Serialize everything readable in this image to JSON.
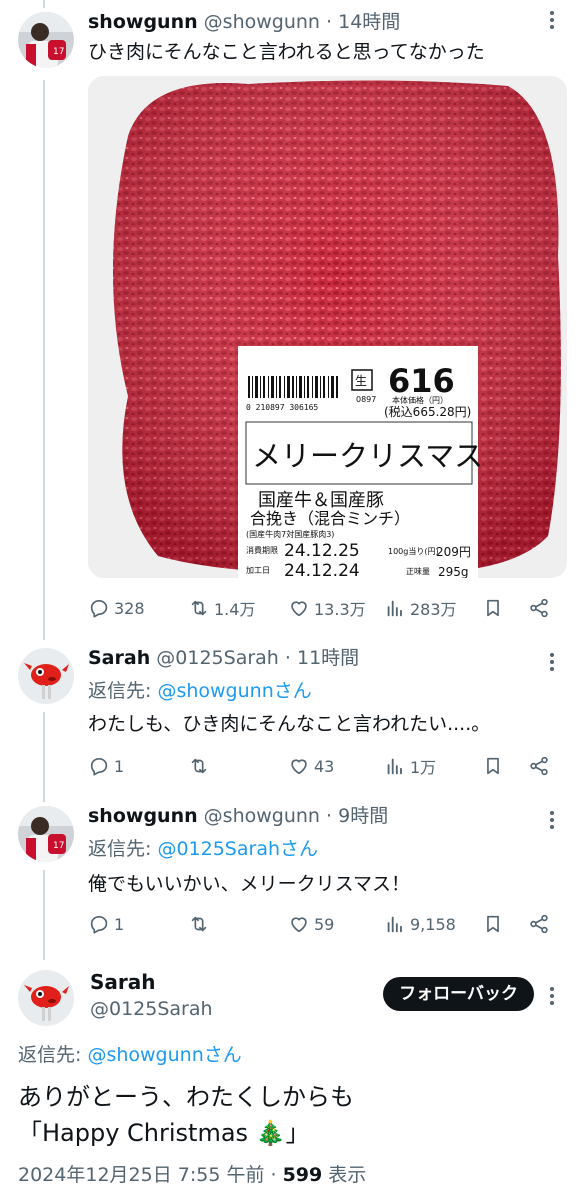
{
  "tweet1": {
    "name": "showgunn",
    "handle": "@showgunn",
    "sep": "·",
    "time": "14時間",
    "text": "ひき肉にそんなこと言われると思ってなかった",
    "image": {
      "label_price": "616",
      "label_price_note": "本体価格（円）",
      "label_tax_price": "(税込665.28円)",
      "label_message": "メリークリスマス",
      "label_product_line1": "国産牛＆国産豚",
      "label_product_line2": "合挽き（混合ミンチ）",
      "label_ratio": "(国産牛肉7対国産豚肉3)",
      "label_expiry_label": "消費期限",
      "label_expiry": "24.12.25",
      "label_unit_label": "100g当り(円)",
      "label_unit_price": "209円",
      "label_processed_label": "加工日",
      "label_processed": "24.12.24",
      "label_weight_label": "正味量",
      "label_weight": "295g",
      "label_barcode_num": "0 210897 306165",
      "label_code": "0897"
    },
    "stats": {
      "replies": "328",
      "retweets": "1.4万",
      "likes": "13.3万",
      "views": "283万"
    }
  },
  "tweet2": {
    "name": "Sarah",
    "handle": "@0125Sarah",
    "sep": "·",
    "time": "11時間",
    "reply_prefix": "返信先: ",
    "reply_mention": "@showgunnさん",
    "text": "わたしも、ひき肉にそんなこと言われたい....。",
    "stats": {
      "replies": "1",
      "retweets": "",
      "likes": "43",
      "views": "1万"
    }
  },
  "tweet3": {
    "name": "showgunn",
    "handle": "@showgunn",
    "sep": "·",
    "time": "9時間",
    "reply_prefix": "返信先: ",
    "reply_mention": "@0125Sarahさん",
    "text": "俺でもいいかい、メリークリスマス！",
    "stats": {
      "replies": "1",
      "retweets": "",
      "likes": "59",
      "views": "9,158"
    }
  },
  "main": {
    "name": "Sarah",
    "handle": "@0125Sarah",
    "follow_button": "フォローバック",
    "reply_prefix": "返信先: ",
    "reply_mention": "@showgunnさん",
    "text_line1": "ありがとーう、わたくしからも",
    "text_line2_open": "「Happy Christmas ",
    "text_line2_emoji": "🎄",
    "text_line2_close": "」",
    "timestamp": "2024年12月25日 7:55 午前",
    "dot": " · ",
    "view_count": "599",
    "view_label": " 表示"
  },
  "colors": {
    "text": "#0f1419",
    "muted": "#536471",
    "link": "#1d9bf0",
    "line": "#cfd9de"
  },
  "icons": [
    "reply-icon",
    "retweet-icon",
    "like-icon",
    "views-icon",
    "bookmark-icon",
    "share-icon",
    "more-icon"
  ]
}
